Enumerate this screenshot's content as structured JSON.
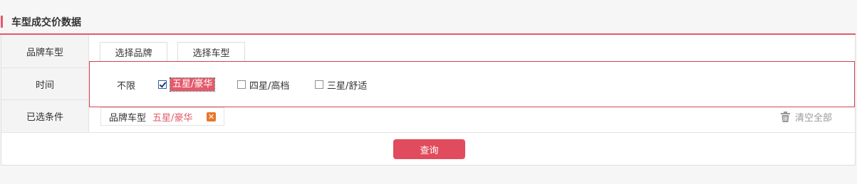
{
  "section": {
    "title": "车型成交价数据"
  },
  "filters": {
    "brand_model": {
      "label": "品牌车型",
      "tabs": [
        {
          "label": "选择品牌"
        },
        {
          "label": "选择车型"
        }
      ]
    },
    "time": {
      "label": "时间",
      "options": [
        {
          "label": "不限",
          "checked": false
        },
        {
          "label": "五星/豪华",
          "checked": true
        },
        {
          "label": "四星/高档",
          "checked": false
        },
        {
          "label": "三星/舒适",
          "checked": false
        }
      ]
    },
    "selected": {
      "label": "已选条件",
      "chip": {
        "category": "品牌车型",
        "value": "五星/豪华",
        "remove_glyph": "✕"
      },
      "clear_all_label": "清空全部"
    }
  },
  "actions": {
    "query_label": "查询"
  },
  "colors": {
    "accent": "#e45a6b",
    "query_button": "#e04c5d",
    "remove_chip": "#e8772b"
  }
}
